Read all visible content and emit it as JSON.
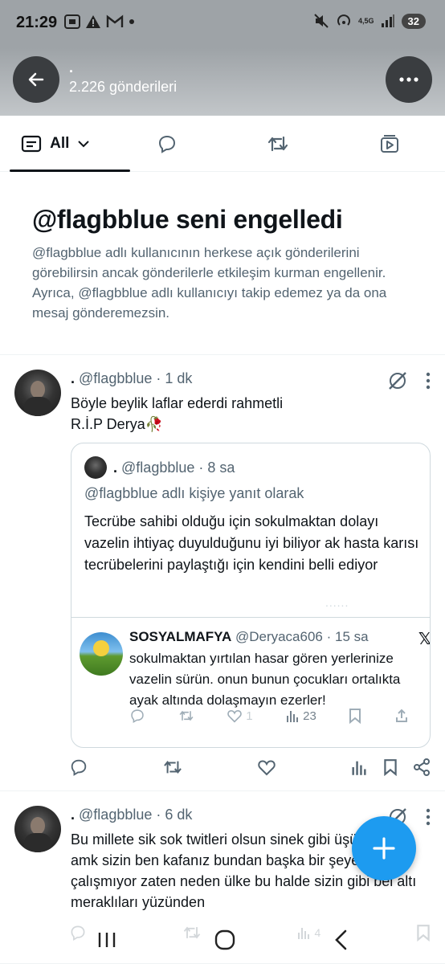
{
  "status_bar": {
    "time": "21:29",
    "network": "4,5G",
    "battery": "32",
    "left_icons": [
      "screenshot-icon",
      "alert-icon",
      "gmail-icon",
      "dot-icon"
    ],
    "right_icons": [
      "mute-icon",
      "hotspot-icon",
      "signal-icon"
    ]
  },
  "header": {
    "title": ".",
    "post_count": "2.226 gönderileri"
  },
  "tabs": [
    {
      "label": "All",
      "icon": "feed-icon",
      "selected": true
    },
    {
      "label": "",
      "icon": "reply-icon"
    },
    {
      "label": "",
      "icon": "retweet-icon"
    },
    {
      "label": "",
      "icon": "media-icon"
    }
  ],
  "blocked": {
    "title": "@flagbblue seni engelledi",
    "text": "@flagbblue adlı kullanıcının herkese açık gönderilerini görebilirsin ancak gönderilerle etkileşim kurman engellenir. Ayrıca, @flagbblue adlı kullanıcıyı takip edemez ya da ona mesaj gönderemezsin."
  },
  "tweets": [
    {
      "name": ".",
      "handle": "@flagbblue",
      "time": "· 1 dk",
      "text_line1": "Böyle beylik laflar ederdi rahmetli",
      "text_line2": "R.İ.P Derya🥀",
      "quote": {
        "name": ".",
        "handle": "@flagbblue",
        "time": "· 8 sa",
        "reply_to": "@flagbblue adlı kişiye yanıt olarak",
        "text": "Tecrübe sahibi olduğu için sokulmaktan dolayı vazelin ihtiyaç duyulduğunu iyi biliyor ak hasta karısı tecrübelerini paylaştığı için kendini belli ediyor",
        "ellipsis": "......",
        "embedded": {
          "name": "SOSYALMAFYA",
          "handle": "@Deryaca606",
          "time": "· 15 sa",
          "source": "𝕏",
          "text": "sokulmaktan yırtılan hasar gören yerlerinize vazelin sürün. onun bunun çocukları ortalıkta ayak altında dolaşmayın ezerler!",
          "likes": "1",
          "views": "23"
        }
      }
    },
    {
      "name": ".",
      "handle": "@flagbblue",
      "time": "· 6 dk",
      "text": "Bu millete sik sok twitleri olsun sinek gibi üşüşüyorlar amk sizin ben kafanız bundan başka bir şeye çalışmıyor zaten neden ülke bu halde sizin gibi bel altı meraklıları yüzünden",
      "views": "4"
    }
  ],
  "colors": {
    "accent": "#1d9bf0",
    "text": "#0f1419",
    "secondary": "#536471",
    "border": "#cfd9de"
  }
}
